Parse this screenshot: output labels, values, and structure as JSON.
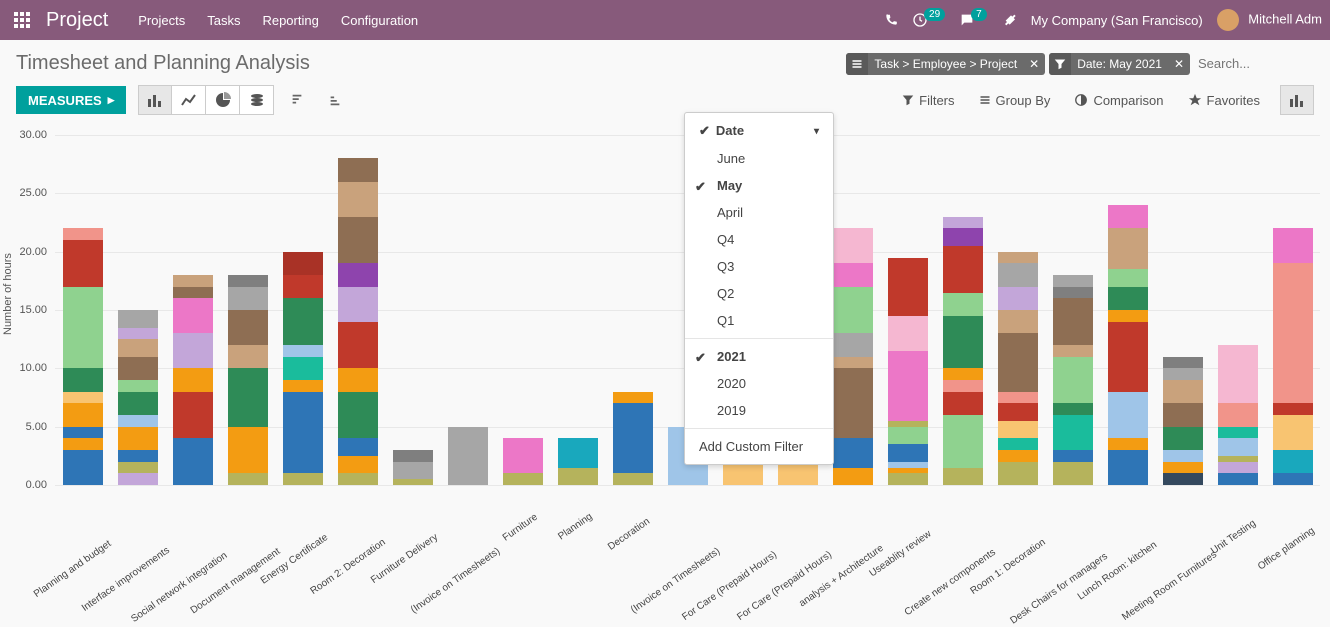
{
  "nav": {
    "brand": "Project",
    "menu": [
      "Projects",
      "Tasks",
      "Reporting",
      "Configuration"
    ],
    "activities_count": "29",
    "messages_count": "7",
    "company": "My Company (San Francisco)",
    "user": "Mitchell Adm"
  },
  "page": {
    "title": "Timesheet and Planning Analysis",
    "facets": [
      {
        "icon": "list",
        "label": "Task > Employee > Project"
      },
      {
        "icon": "filter",
        "label": "Date: May 2021"
      }
    ],
    "search_placeholder": "Search..."
  },
  "controls": {
    "measures_label": "MEASURES",
    "filters_label": "Filters",
    "groupby_label": "Group By",
    "comparison_label": "Comparison",
    "favorites_label": "Favorites"
  },
  "filter_dropdown": {
    "header": "Date",
    "options": [
      "June",
      "May",
      "April",
      "Q4",
      "Q3",
      "Q2",
      "Q1"
    ],
    "selected_option": "May",
    "years": [
      "2021",
      "2020",
      "2019"
    ],
    "selected_year": "2021",
    "add_label": "Add Custom Filter"
  },
  "chart_data": {
    "type": "bar",
    "ylabel": "Number of hours",
    "ylim": [
      0,
      30
    ],
    "yticks": [
      0.0,
      5.0,
      10.0,
      15.0,
      20.0,
      25.0,
      30.0
    ],
    "colors": {
      "blue": "#2e75b6",
      "orange": "#f39c12",
      "teal": "#1abc9c",
      "green": "#2e8b57",
      "lgreen": "#8fd28f",
      "red": "#c0392b",
      "dred": "#a93226",
      "brown": "#8e6e53",
      "tan": "#c9a27c",
      "pink": "#ec77c7",
      "lpink": "#f5b7d1",
      "purple": "#8e44ad",
      "lpurple": "#c3a6d9",
      "grey": "#a6a6a6",
      "dgrey": "#7f7f7f",
      "yellow": "#d4c95a",
      "olive": "#b5b35c",
      "lblue": "#9fc5e8",
      "navy": "#34495e",
      "cyan": "#19a8bd",
      "salmon": "#f1948a",
      "peach": "#f8c471"
    },
    "categories": [
      "Planning and budget",
      "Interface improvements",
      "Social network integration",
      "Document management",
      "Energy Certificate",
      "Room 2: Decoration",
      "Furniture Delivery",
      "(Invoice on Timesheets)",
      "Furniture",
      "Planning",
      "Decoration",
      "(Invoice on Timesheets)",
      "For Care (Prepaid Hours)",
      "For Care (Prepaid Hours)",
      "analysis + Architecture",
      "Useablity review",
      "Create new components",
      "Room 1: Decoration",
      "Desk Chairs for managers",
      "Lunch Room: kitchen",
      "Meeting Room Furnitures",
      "Unit Testing",
      "Office planning"
    ],
    "stacks": [
      [
        [
          "blue",
          3
        ],
        [
          "orange",
          1
        ],
        [
          "blue",
          1
        ],
        [
          "orange",
          2
        ],
        [
          "peach",
          1
        ],
        [
          "green",
          2
        ],
        [
          "lgreen",
          7
        ],
        [
          "red",
          4
        ],
        [
          "salmon",
          1
        ]
      ],
      [
        [
          "lpurple",
          1
        ],
        [
          "olive",
          1
        ],
        [
          "blue",
          1
        ],
        [
          "orange",
          2
        ],
        [
          "lblue",
          1
        ],
        [
          "green",
          2
        ],
        [
          "lgreen",
          1
        ],
        [
          "brown",
          2
        ],
        [
          "tan",
          1.5
        ],
        [
          "lpurple",
          1
        ],
        [
          "grey",
          1.5
        ]
      ],
      [
        [
          "blue",
          4
        ],
        [
          "red",
          4
        ],
        [
          "orange",
          2
        ],
        [
          "lpurple",
          3
        ],
        [
          "pink",
          3
        ],
        [
          "brown",
          1
        ],
        [
          "tan",
          1
        ]
      ],
      [
        [
          "olive",
          1
        ],
        [
          "orange",
          4
        ],
        [
          "green",
          5
        ],
        [
          "tan",
          2
        ],
        [
          "brown",
          3
        ],
        [
          "grey",
          2
        ],
        [
          "dgrey",
          1
        ]
      ],
      [
        [
          "olive",
          1
        ],
        [
          "blue",
          7
        ],
        [
          "orange",
          1
        ],
        [
          "teal",
          2
        ],
        [
          "lblue",
          1
        ],
        [
          "green",
          4
        ],
        [
          "red",
          2
        ],
        [
          "dred",
          2
        ]
      ],
      [
        [
          "olive",
          1
        ],
        [
          "orange",
          1.5
        ],
        [
          "blue",
          1.5
        ],
        [
          "green",
          4
        ],
        [
          "orange",
          2
        ],
        [
          "red",
          4
        ],
        [
          "lpurple",
          3
        ],
        [
          "purple",
          2
        ],
        [
          "brown",
          4
        ],
        [
          "tan",
          3
        ],
        [
          "brown",
          2
        ]
      ],
      [
        [
          "olive",
          0.5
        ],
        [
          "grey",
          1.5
        ],
        [
          "dgrey",
          1
        ]
      ],
      [
        [
          "grey",
          5
        ]
      ],
      [
        [
          "olive",
          1
        ],
        [
          "pink",
          3
        ]
      ],
      [
        [
          "olive",
          1.5
        ],
        [
          "cyan",
          2.5
        ]
      ],
      [
        [
          "olive",
          1
        ],
        [
          "blue",
          6
        ],
        [
          "orange",
          1
        ]
      ],
      [
        [
          "lblue",
          5
        ]
      ],
      [
        [
          "peach",
          5
        ]
      ],
      [
        [
          "peach",
          5
        ],
        [
          "green",
          3
        ]
      ],
      [
        [
          "orange",
          1.5
        ],
        [
          "blue",
          2.5
        ],
        [
          "brown",
          6
        ],
        [
          "tan",
          1
        ],
        [
          "grey",
          2
        ],
        [
          "lgreen",
          4
        ],
        [
          "pink",
          2
        ],
        [
          "lpink",
          3
        ]
      ],
      [
        [
          "olive",
          1
        ],
        [
          "orange",
          0.5
        ],
        [
          "lblue",
          0.5
        ],
        [
          "blue",
          1.5
        ],
        [
          "lgreen",
          1.5
        ],
        [
          "olive",
          0.5
        ],
        [
          "pink",
          6
        ],
        [
          "lpink",
          3
        ],
        [
          "red",
          5
        ]
      ],
      [
        [
          "olive",
          1.5
        ],
        [
          "lgreen",
          4.5
        ],
        [
          "red",
          2
        ],
        [
          "salmon",
          1
        ],
        [
          "orange",
          1
        ],
        [
          "green",
          4.5
        ],
        [
          "lgreen",
          2
        ],
        [
          "red",
          4
        ],
        [
          "purple",
          1.5
        ],
        [
          "lpurple",
          1
        ]
      ],
      [
        [
          "olive",
          2
        ],
        [
          "orange",
          1
        ],
        [
          "teal",
          1
        ],
        [
          "peach",
          1.5
        ],
        [
          "red",
          1.5
        ],
        [
          "salmon",
          1
        ],
        [
          "brown",
          5
        ],
        [
          "tan",
          2
        ],
        [
          "lpurple",
          2
        ],
        [
          "grey",
          2
        ],
        [
          "tan",
          1
        ]
      ],
      [
        [
          "olive",
          2
        ],
        [
          "blue",
          1
        ],
        [
          "teal",
          3
        ],
        [
          "green",
          1
        ],
        [
          "lgreen",
          4
        ],
        [
          "tan",
          1
        ],
        [
          "brown",
          4
        ],
        [
          "dgrey",
          1
        ],
        [
          "grey",
          1
        ]
      ],
      [
        [
          "blue",
          3
        ],
        [
          "orange",
          1
        ],
        [
          "lblue",
          4
        ],
        [
          "red",
          6
        ],
        [
          "orange",
          1
        ],
        [
          "green",
          2
        ],
        [
          "lgreen",
          1.5
        ],
        [
          "tan",
          3.5
        ],
        [
          "pink",
          2
        ]
      ],
      [
        [
          "navy",
          1
        ],
        [
          "orange",
          1
        ],
        [
          "lblue",
          1
        ],
        [
          "green",
          2
        ],
        [
          "brown",
          2
        ],
        [
          "tan",
          2
        ],
        [
          "grey",
          1
        ],
        [
          "dgrey",
          1
        ]
      ],
      [
        [
          "blue",
          1
        ],
        [
          "lpurple",
          1
        ],
        [
          "olive",
          0.5
        ],
        [
          "lblue",
          1.5
        ],
        [
          "teal",
          1
        ],
        [
          "salmon",
          2
        ],
        [
          "lpink",
          5
        ]
      ],
      [
        [
          "blue",
          1
        ],
        [
          "cyan",
          2
        ],
        [
          "peach",
          3
        ],
        [
          "red",
          1
        ],
        [
          "salmon",
          12
        ],
        [
          "pink",
          3
        ]
      ]
    ]
  }
}
